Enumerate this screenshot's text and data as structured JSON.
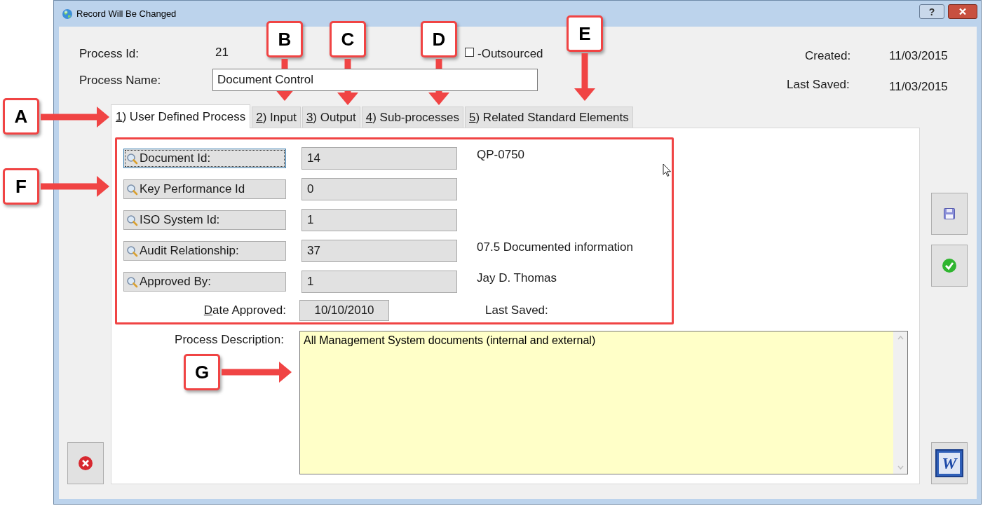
{
  "window": {
    "title": "Record Will Be Changed",
    "help_glyph": "?"
  },
  "header": {
    "process_id_label": "Process Id:",
    "process_id": "21",
    "outsourced": {
      "label": "-Outsourced",
      "checked": false
    },
    "process_name_label": "Process Name:",
    "process_name": "Document Control",
    "created_label": "Created:",
    "created": "11/03/2015",
    "last_saved_label": "Last Saved:",
    "last_saved": "11/03/2015"
  },
  "tabs": [
    {
      "label": "1) User Defined Process",
      "selected": true
    },
    {
      "label": "2) Input",
      "selected": false
    },
    {
      "label": "3) Output",
      "selected": false
    },
    {
      "label": "4) Sub-processes",
      "selected": false
    },
    {
      "label": "5) Related Standard Elements",
      "selected": false
    }
  ],
  "lookups": [
    {
      "label": "Document Id:",
      "value": "14",
      "description": "QP-0750",
      "focused": true
    },
    {
      "label": "Key Performance Id",
      "value": "0",
      "focused": false
    },
    {
      "label": "ISO System Id:",
      "value": "1",
      "focused": false
    },
    {
      "label": "Audit Relationship:",
      "value": "37",
      "description": "07.5 Documented information",
      "focused": false
    },
    {
      "label": "Approved By:",
      "value": "1",
      "description": "Jay D. Thomas",
      "focused": false
    }
  ],
  "date_approved": {
    "label": "Date Approved:",
    "value": "10/10/2010"
  },
  "last_saved_label": "Last Saved:",
  "description": {
    "label": "Process Description:",
    "value": "All Management System documents (internal and external)"
  },
  "word_button": {
    "glyph": "W"
  },
  "callouts": [
    {
      "letter": "A"
    },
    {
      "letter": "B"
    },
    {
      "letter": "C"
    },
    {
      "letter": "D"
    },
    {
      "letter": "E"
    },
    {
      "letter": "F"
    },
    {
      "letter": "G"
    }
  ]
}
